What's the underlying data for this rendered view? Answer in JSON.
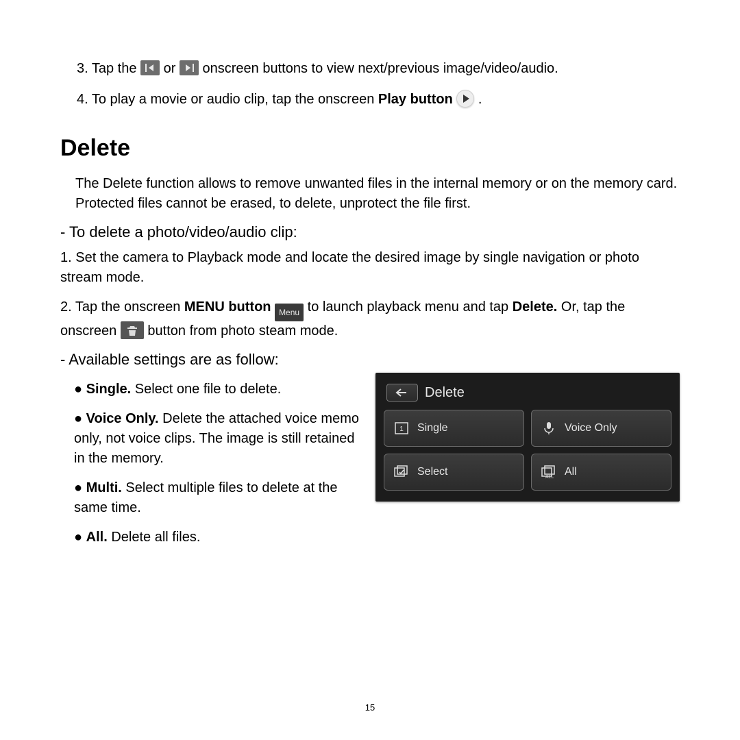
{
  "steps_top": {
    "s3_a": "3.   Tap the ",
    "s3_b": " or ",
    "s3_c": " onscreen buttons to view next/previous image/video/audio.",
    "s4_a": "4.   To play a movie or audio clip, tap the onscreen ",
    "s4_bold": "Play button",
    "s4_b": " ",
    "s4_c": " ."
  },
  "heading": "Delete",
  "intro": "The Delete function allows to remove unwanted files in the internal memory or on the memory card. Protected files cannot be erased, to delete, unprotect the file first.",
  "sub1": "- To delete a photo/video/audio clip:",
  "step1": "1.   Set the camera to Playback mode and locate the desired image by single navigation or photo stream mode.",
  "step2": {
    "a": "2.   Tap the onscreen ",
    "bold1": "MENU button",
    "b": " ",
    "menu_label": "Menu",
    "c": " to launch playback menu and tap ",
    "bold2": "Delete.",
    "d": " Or, tap the onscreen ",
    "e": " button from photo steam mode."
  },
  "sub2": "- Available settings are as follow:",
  "bullets": {
    "single_bold": "Single.",
    "single_rest": " Select one file to delete.",
    "voice_bold": "Voice Only.",
    "voice_rest": " Delete the attached voice memo only, not voice clips. The image is still retained in the memory.",
    "multi_bold": "Multi.",
    "multi_rest": " Select multiple files to delete at the same time.",
    "all_bold": "All.",
    "all_rest": " Delete all files."
  },
  "panel": {
    "title": "Delete",
    "options": {
      "single": "Single",
      "voice": "Voice Only",
      "select": "Select",
      "all": "All"
    }
  },
  "page_number": "15"
}
